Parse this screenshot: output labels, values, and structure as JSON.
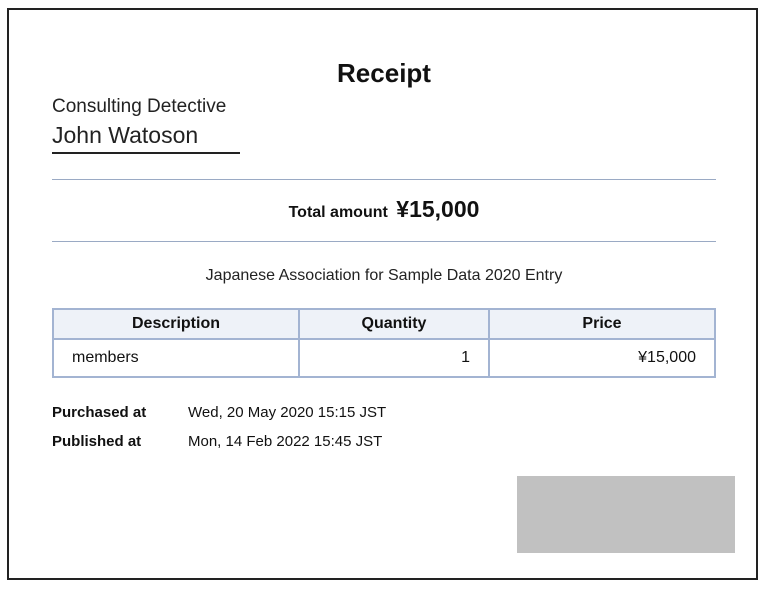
{
  "receipt": {
    "title": "Receipt",
    "recipient_role": "Consulting Detective",
    "recipient_name": "John Watoson",
    "total_label": "Total amount",
    "total_value": "¥15,000",
    "event": "Japanese Association for Sample Data 2020 Entry"
  },
  "table": {
    "headers": [
      "Description",
      "Quantity",
      "Price"
    ],
    "rows": [
      {
        "description": "members",
        "quantity": "1",
        "price": "¥15,000"
      }
    ]
  },
  "meta": {
    "purchased_label": "Purchased at",
    "purchased_value": "Wed, 20 May 2020 15:15 JST",
    "published_label": "Published at",
    "published_value": "Mon, 14 Feb 2022 15:45 JST"
  },
  "colors": {
    "rule": "#9aaac4",
    "table_border": "#a3b4d2",
    "header_bg": "#eef2f8",
    "redaction": "#c1c1c1"
  }
}
